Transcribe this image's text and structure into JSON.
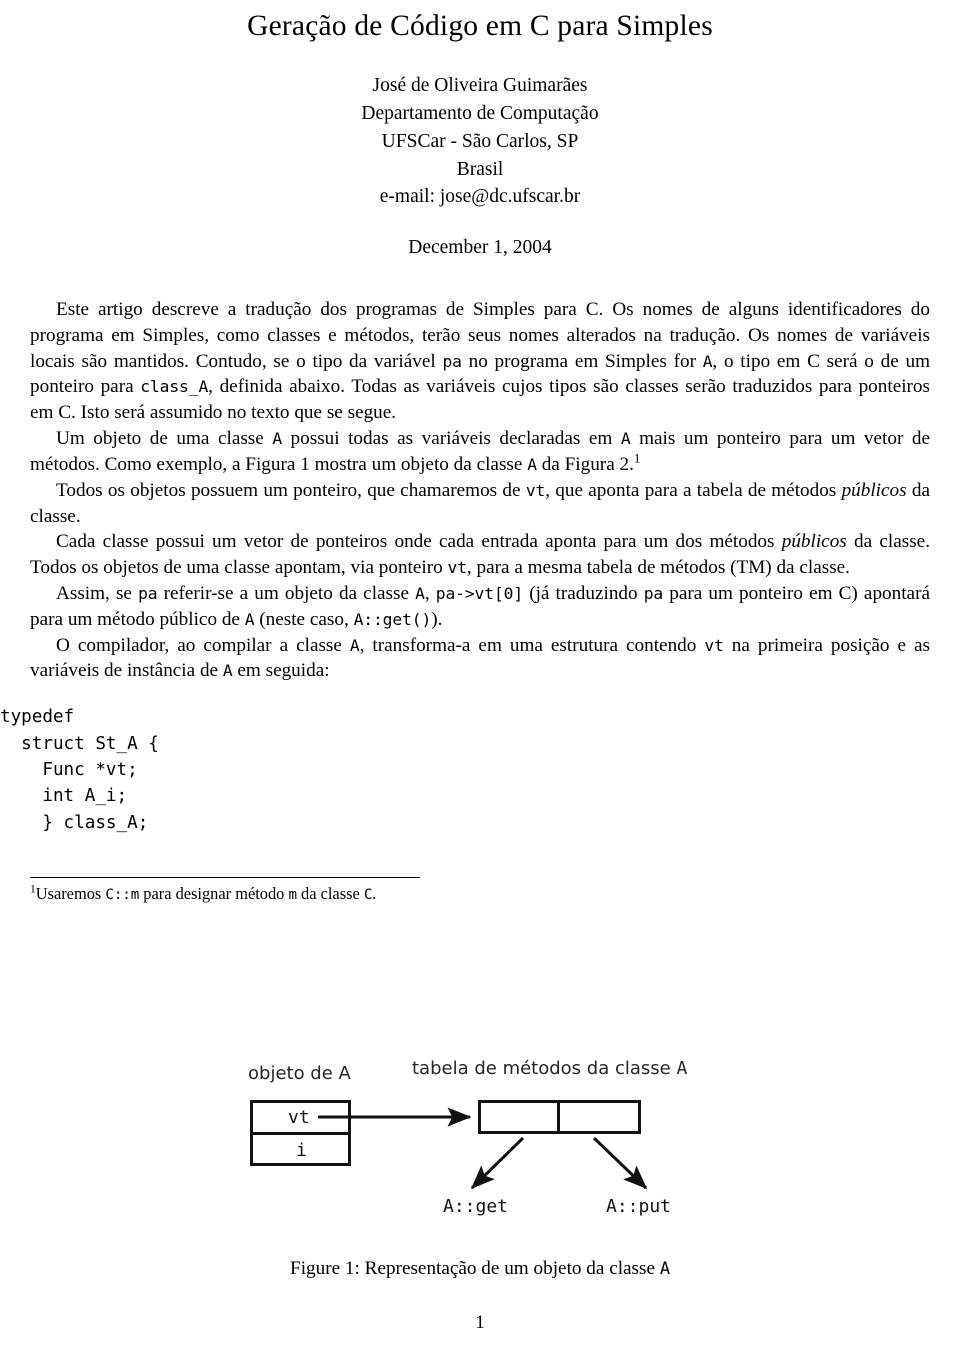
{
  "document": {
    "title": "Geração de Código em C para Simples",
    "author": {
      "name": "José de Oliveira Guimarães",
      "department": "Departamento de Computação",
      "institution": "UFSCar - São Carlos, SP",
      "country": "Brasil",
      "email_line": "e-mail: jose@dc.ufscar.br"
    },
    "date": "December 1, 2004",
    "page_number": "1"
  },
  "paragraphs": {
    "p1_a": "Este artigo descreve a tradução dos programas de Simples para C. Os nomes de alguns identificadores do programa em Simples, como classes e métodos, terão seus nomes alterados na tradução. Os nomes de variáveis locais são mantidos. Contudo, se o tipo da variável ",
    "p1_code1": "pa",
    "p1_b": " no programa em Simples for ",
    "p1_code2": "A",
    "p1_c": ", o tipo em C será o de um ponteiro para ",
    "p1_code3": "class_A",
    "p1_d": ", definida abaixo. Todas as variáveis cujos tipos são classes serão traduzidos para ponteiros em C. Isto será assumido no texto que se segue.",
    "p2_a": "Um objeto de uma classe ",
    "p2_code1": "A",
    "p2_b": " possui todas as variáveis declaradas em ",
    "p2_code2": "A",
    "p2_c": " mais um ponteiro para um vetor de métodos. Como exemplo, a Figura 1 mostra um objeto da classe ",
    "p2_code3": "A",
    "p2_d": " da Figura 2.",
    "p2_footnote_marker": "1",
    "p3_a": "Todos os objetos possuem um ponteiro, que chamaremos de ",
    "p3_code1": "vt",
    "p3_b": ", que aponta para a tabela de métodos ",
    "p3_italic1": "públicos",
    "p3_c": " da classe.",
    "p4_a": "Cada classe possui um vetor de ponteiros onde cada entrada aponta para um dos métodos ",
    "p4_italic1": "públicos",
    "p4_b": " da classe. Todos os objetos de uma classe apontam, via ponteiro ",
    "p4_code1": "vt",
    "p4_c": ", para a mesma tabela de métodos (TM) da classe.",
    "p5_a": "Assim, se ",
    "p5_code1": "pa",
    "p5_b": " referir-se a um objeto da classe ",
    "p5_code2": "A",
    "p5_c": ", ",
    "p5_code3": "pa->vt[0]",
    "p5_d": " (já traduzindo ",
    "p5_code4": "pa",
    "p5_e": " para um ponteiro em C) apontará para um método público de ",
    "p5_code5": "A",
    "p5_f": " (neste caso, ",
    "p5_code6": "A::get()",
    "p5_g": ").",
    "p6_a": "O compilador, ao compilar a classe ",
    "p6_code1": "A",
    "p6_b": ", transforma-a em uma estrutura contendo ",
    "p6_code2": "vt",
    "p6_c": " na primeira posição e as variáveis de instância de ",
    "p6_code3": "A",
    "p6_d": " em seguida:"
  },
  "code_block": {
    "lines": [
      "typedef",
      "  struct St_A {",
      "    Func *vt;",
      "    int A_i;",
      "    } class_A;"
    ],
    "text": "typedef\n  struct St_A {\n    Func *vt;\n    int A_i;\n    } class_A;"
  },
  "footnote": {
    "marker": "1",
    "a": "Usaremos ",
    "code1": "C::m",
    "b": " para designar método ",
    "code2": "m",
    "c": " da classe ",
    "code3": "C",
    "d": "."
  },
  "figure": {
    "object_label": "objeto de A",
    "table_label_text": "tabela de métodos da classe",
    "table_label_class": "A",
    "object_fields": [
      "vt",
      "i"
    ],
    "method_labels": [
      "A::get",
      "A::put"
    ],
    "caption_prefix": "Figure 1: Representação de um objeto da classe ",
    "caption_class": "A"
  },
  "colors": {
    "text": "#000000",
    "figure_stroke": "#111111",
    "background": "#ffffff"
  }
}
